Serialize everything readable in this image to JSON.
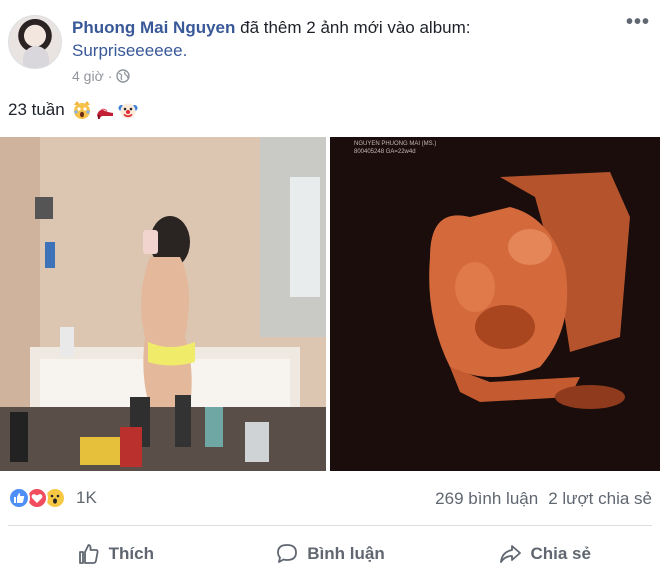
{
  "post": {
    "author": "Phuong Mai Nguyen",
    "action_text": "đã thêm 2 ảnh mới vào album:",
    "album_name": "Surpriseeeeee.",
    "time": "4 giờ",
    "separator": "·",
    "more_label": "•••",
    "status_text": "23 tuần",
    "status_emojis": [
      "scream-cat-emoji",
      "high-heel-emoji",
      "clown-emoji"
    ]
  },
  "photos": [
    {
      "name": "bathroom-selfie-photo"
    },
    {
      "name": "ultrasound-3d-photo",
      "overlay_text_1": "NGUYEN PHUONG MAI (MS.)",
      "overlay_text_2": "800405248 GA=22w4d"
    }
  ],
  "reactions": {
    "types": [
      "like",
      "love",
      "wow"
    ],
    "count": "1K"
  },
  "stats": {
    "comments": "269 bình luận",
    "shares": "2 lượt chia sẻ"
  },
  "actions": {
    "like": "Thích",
    "comment": "Bình luận",
    "share": "Chia sẻ"
  },
  "colors": {
    "author_link": "#385898",
    "meta_gray": "#90949c",
    "action_gray": "#606770",
    "like_blue": "#4e8ef7",
    "love_red": "#f04d5f",
    "wow_yellow": "#f7c844"
  }
}
